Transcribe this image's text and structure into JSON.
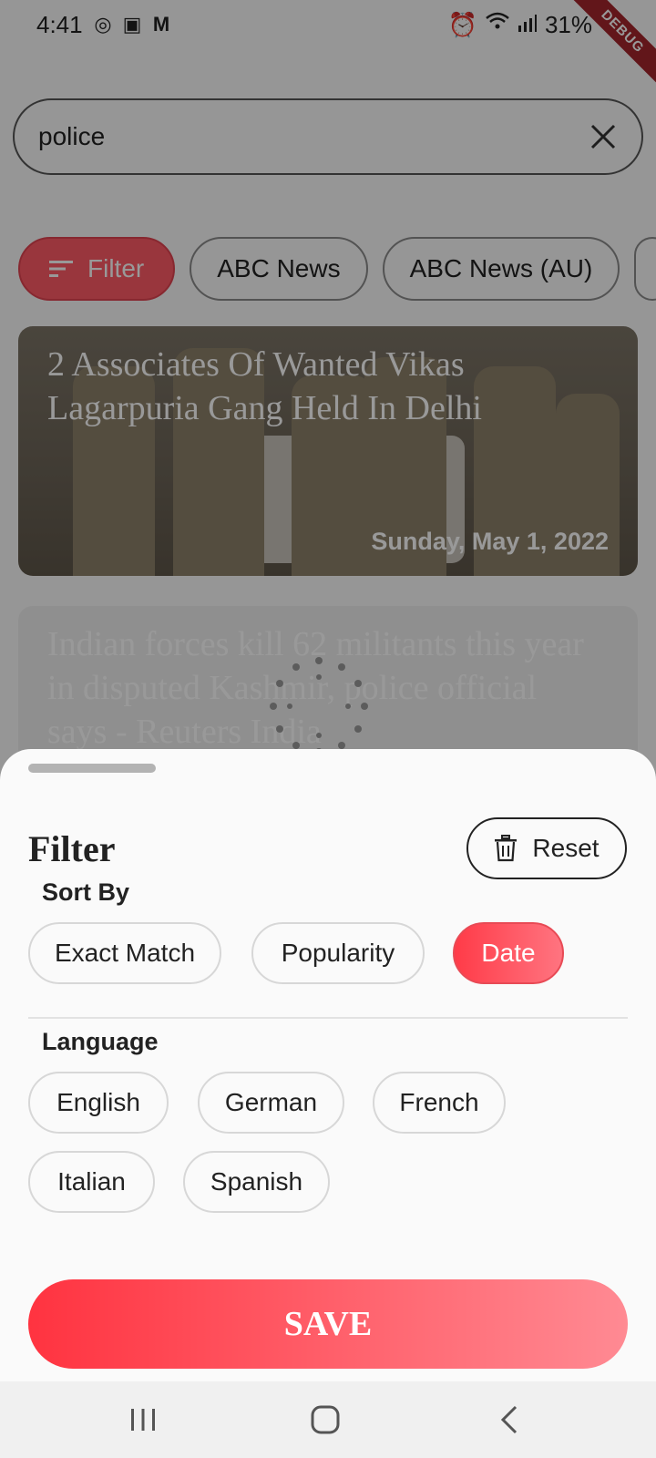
{
  "status_bar": {
    "time": "4:41",
    "app_icons": [
      "whatsapp-icon",
      "linkedin-icon",
      "gmail-icon"
    ],
    "battery": "31%",
    "debug_label": "DEBUG"
  },
  "search": {
    "value": "police"
  },
  "chips": {
    "filter_label": "Filter",
    "sources": [
      "ABC News",
      "ABC News (AU)"
    ]
  },
  "articles": [
    {
      "title": "2 Associates Of Wanted Vikas Lagarpuria Gang Held In Delhi",
      "date": "Sunday, May 1, 2022"
    },
    {
      "title": "Indian forces kill 62 militants this year in disputed Kashmir, police official says - Reuters India",
      "date": ""
    }
  ],
  "sheet": {
    "title": "Filter",
    "reset_label": "Reset",
    "sort_by": {
      "label": "Sort By",
      "options": [
        "Exact Match",
        "Popularity",
        "Date"
      ],
      "selected": "Date"
    },
    "language": {
      "label": "Language",
      "options": [
        "English",
        "German",
        "French",
        "Italian",
        "Spanish"
      ]
    },
    "save_label": "SAVE"
  },
  "colors": {
    "accent": "#ff3b48",
    "accent_light": "#ff8a93"
  }
}
